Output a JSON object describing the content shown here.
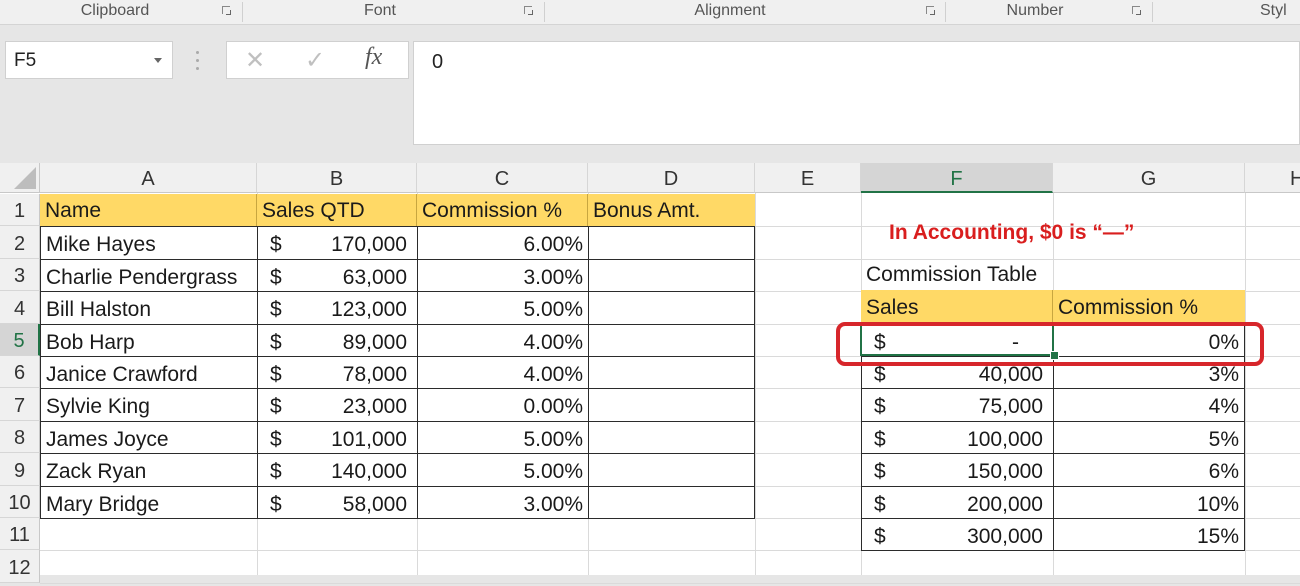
{
  "ribbon": {
    "groups": [
      "Clipboard",
      "Font",
      "Alignment",
      "Number",
      "Styl"
    ]
  },
  "formula_bar": {
    "name_box": "F5",
    "cancel_icon": "✕",
    "enter_icon": "✓",
    "fx_label": "fx",
    "formula_value": "0"
  },
  "columns": [
    "A",
    "B",
    "C",
    "D",
    "E",
    "F",
    "G",
    "H"
  ],
  "selected_column": "F",
  "rows": [
    "1",
    "2",
    "3",
    "4",
    "5",
    "6",
    "7",
    "8",
    "9",
    "10",
    "11",
    "12"
  ],
  "selected_row": "5",
  "sales_table": {
    "headers": [
      "Name",
      "Sales QTD",
      "Commission %",
      "Bonus Amt."
    ],
    "currency_symbol": "$",
    "rows": [
      {
        "name": "Mike Hayes",
        "sales": "170,000",
        "commission": "6.00%",
        "bonus": ""
      },
      {
        "name": "Charlie Pendergrass",
        "sales": "63,000",
        "commission": "3.00%",
        "bonus": ""
      },
      {
        "name": "Bill Halston",
        "sales": "123,000",
        "commission": "5.00%",
        "bonus": ""
      },
      {
        "name": "Bob Harp",
        "sales": "89,000",
        "commission": "4.00%",
        "bonus": ""
      },
      {
        "name": "Janice Crawford",
        "sales": "78,000",
        "commission": "4.00%",
        "bonus": ""
      },
      {
        "name": "Sylvie King",
        "sales": "23,000",
        "commission": "0.00%",
        "bonus": ""
      },
      {
        "name": "James Joyce",
        "sales": "101,000",
        "commission": "5.00%",
        "bonus": ""
      },
      {
        "name": "Zack Ryan",
        "sales": "140,000",
        "commission": "5.00%",
        "bonus": ""
      },
      {
        "name": "Mary Bridge",
        "sales": "58,000",
        "commission": "3.00%",
        "bonus": ""
      }
    ]
  },
  "annotation": "In Accounting, $0 is “—”",
  "commission_table": {
    "title": "Commission Table",
    "headers": [
      "Sales",
      "Commission %"
    ],
    "currency_symbol": "$",
    "rows": [
      {
        "sales": "-",
        "pct": "0%"
      },
      {
        "sales": "40,000",
        "pct": "3%"
      },
      {
        "sales": "75,000",
        "pct": "4%"
      },
      {
        "sales": "100,000",
        "pct": "5%"
      },
      {
        "sales": "150,000",
        "pct": "6%"
      },
      {
        "sales": "200,000",
        "pct": "10%"
      },
      {
        "sales": "300,000",
        "pct": "15%"
      }
    ]
  },
  "colors": {
    "header_fill": "#ffd966",
    "selection": "#217346",
    "annotation": "#d91e1e"
  }
}
